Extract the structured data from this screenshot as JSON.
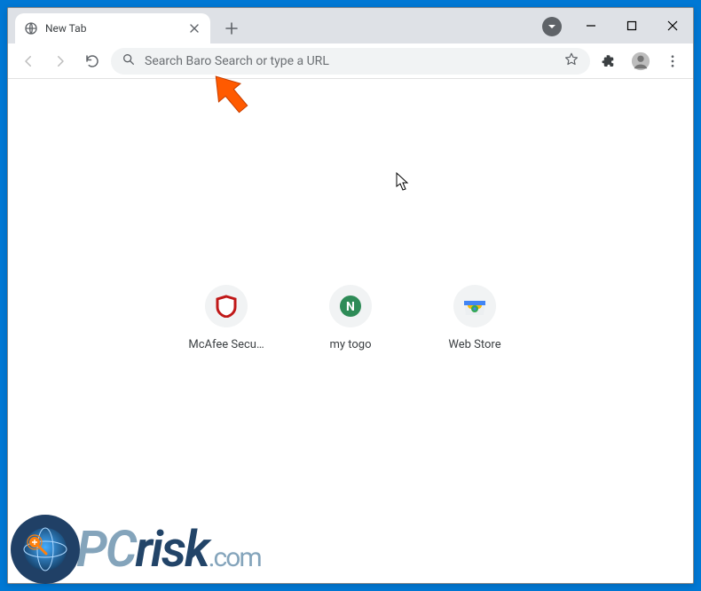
{
  "tab": {
    "title": "New Tab"
  },
  "omnibox": {
    "placeholder": "Search Baro Search or type a URL",
    "value": ""
  },
  "shortcuts": [
    {
      "label": "McAfee Secu…",
      "kind": "mcafee"
    },
    {
      "label": "my togo",
      "kind": "mytogo"
    },
    {
      "label": "Web Store",
      "kind": "webstore"
    }
  ],
  "watermark": {
    "pc_text": "PC",
    "risk_text": "risk",
    "dotcom_text": ".com"
  },
  "colors": {
    "window_border": "#0078d4",
    "tab_strip": "#dee1e6",
    "omnibox_bg": "#f1f3f4",
    "arrow_fill": "#ff5a00"
  }
}
